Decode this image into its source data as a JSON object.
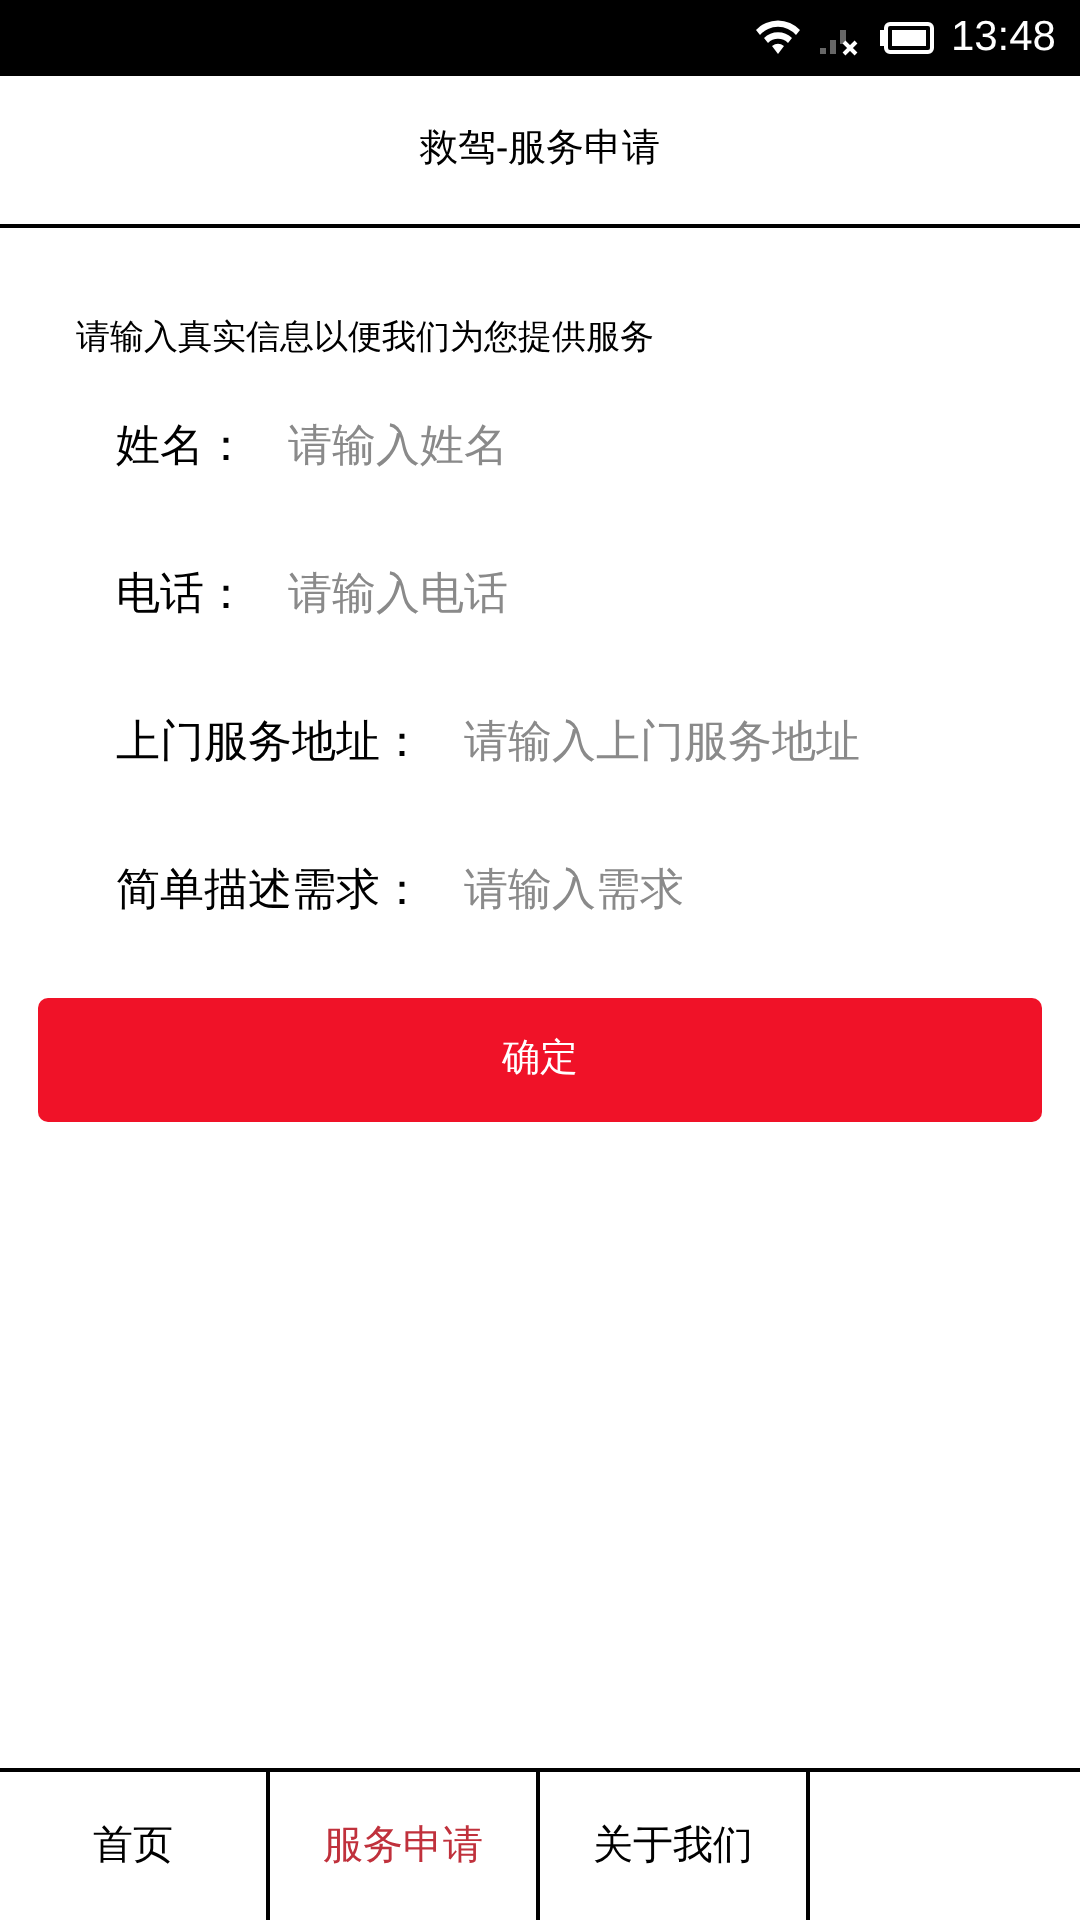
{
  "status_bar": {
    "time": "13:48"
  },
  "header": {
    "title": "救驾-服务申请"
  },
  "intro": "请输入真实信息以便我们为您提供服务",
  "fields": [
    {
      "label": "姓名：",
      "placeholder": "请输入姓名"
    },
    {
      "label": "电话：",
      "placeholder": "请输入电话"
    },
    {
      "label": "上门服务地址：",
      "placeholder": "请输入上门服务地址"
    },
    {
      "label": "简单描述需求：",
      "placeholder": "请输入需求"
    }
  ],
  "submit": "确定",
  "tabs": [
    {
      "label": "首页",
      "selected": false
    },
    {
      "label": "服务申请",
      "selected": true
    },
    {
      "label": "关于我们",
      "selected": false
    }
  ]
}
